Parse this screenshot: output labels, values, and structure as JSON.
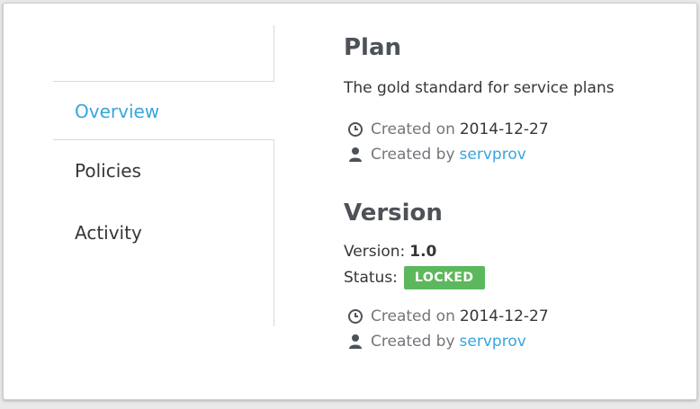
{
  "tabs": [
    {
      "label": "Overview",
      "active": true
    },
    {
      "label": "Policies",
      "active": false
    },
    {
      "label": "Activity",
      "active": false
    }
  ],
  "plan": {
    "title": "Plan",
    "description": "The gold standard for service plans",
    "created_on_label": "Created on",
    "created_on": "2014-12-27",
    "created_by_label": "Created by",
    "created_by": "servprov"
  },
  "version": {
    "title": "Version",
    "version_label": "Version:",
    "version_value": "1.0",
    "status_label": "Status:",
    "status_value": "LOCKED",
    "created_on_label": "Created on",
    "created_on": "2014-12-27",
    "created_by_label": "Created by",
    "created_by": "servprov"
  },
  "icons": {
    "clock": "clock-icon",
    "user": "user-icon"
  },
  "colors": {
    "accent": "#39a5dc",
    "status_locked": "#5cb85c",
    "muted": "#72767b",
    "title": "#4d5258"
  }
}
